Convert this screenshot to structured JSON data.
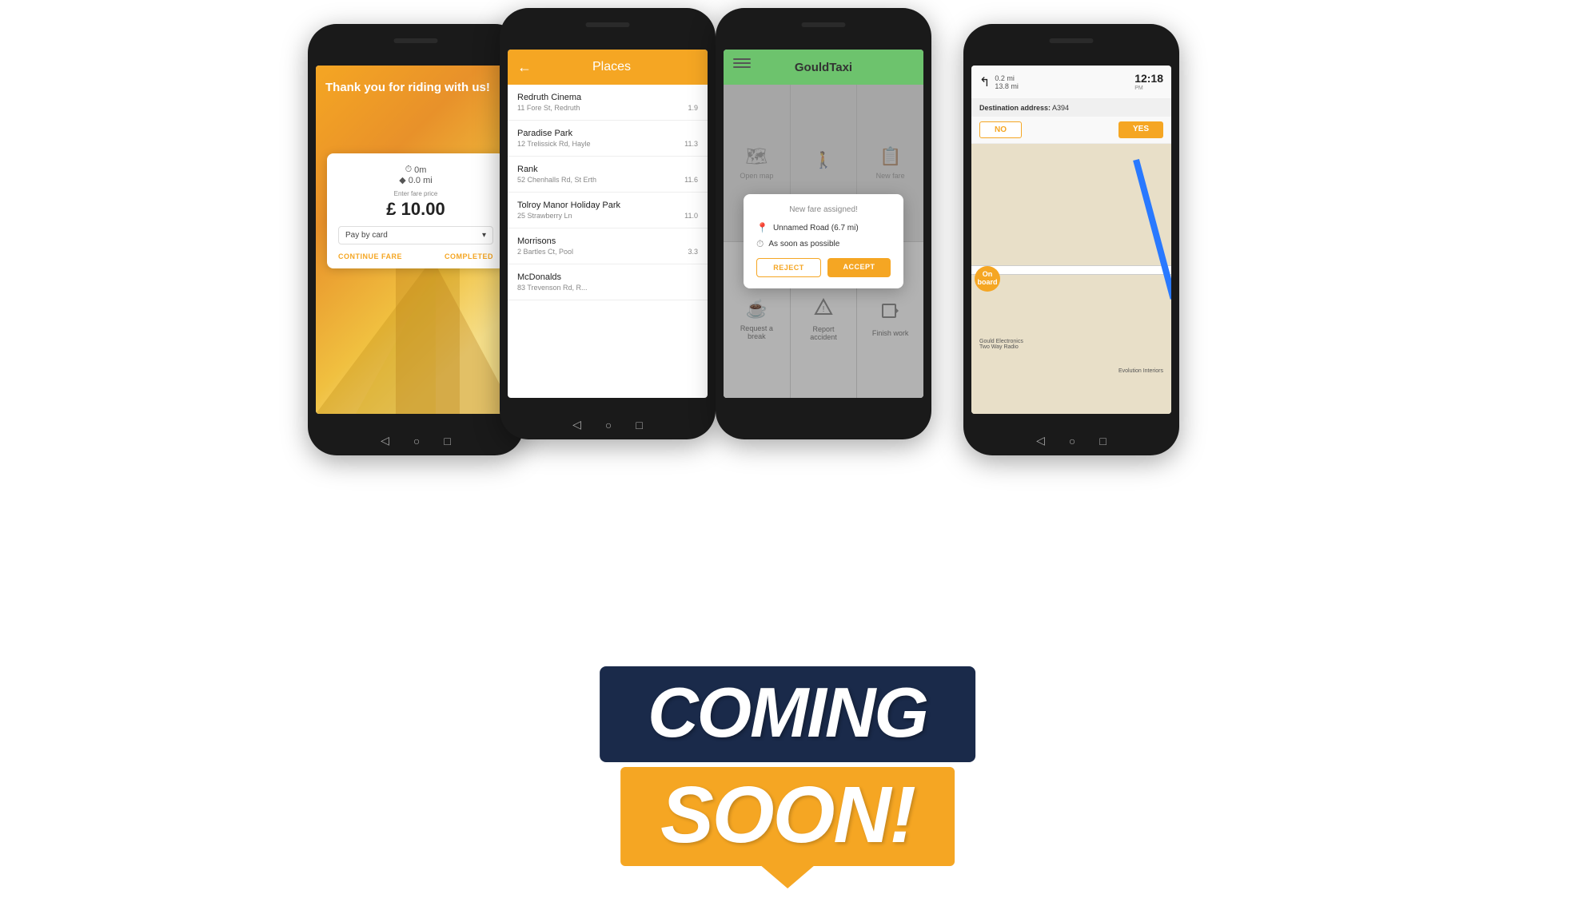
{
  "page": {
    "background": "#ffffff"
  },
  "phone1": {
    "thank_you": "Thank you for riding with us!",
    "time": "0m",
    "distance": "0.0 mi",
    "fare_label": "Enter fare price",
    "price": "£ 10.00",
    "payment": "Pay by card",
    "btn_continue": "CONTINUE FARE",
    "btn_completed": "COMPLETED"
  },
  "phone2": {
    "header_title": "Places",
    "back_arrow": "←",
    "places": [
      {
        "name": "Redruth Cinema",
        "address": "11 Fore St, Redruth",
        "distance": "1.9"
      },
      {
        "name": "Paradise Park",
        "address": "12 Trelissick Rd, Hayle",
        "distance": "11.3"
      },
      {
        "name": "Rank",
        "address": "52 Chenhalls Rd, St Erth",
        "distance": "11.6"
      },
      {
        "name": "Tolroy Manor Holiday Park",
        "address": "25 Strawberry Ln",
        "distance": "11.0"
      },
      {
        "name": "Morrisons",
        "address": "2 Bartles Ct, Pool",
        "distance": "3.3"
      },
      {
        "name": "McDonalds",
        "address": "83 Trevenson Rd, R...",
        "distance": ""
      }
    ]
  },
  "phone3": {
    "app_name": "GouldTaxi",
    "modal": {
      "title": "New fare assigned!",
      "location": "Unnamed Road (6.7 mi)",
      "timing": "As soon as possible",
      "btn_reject": "REJECT",
      "btn_accept": "ACCEPT"
    },
    "grid": [
      {
        "label": "Open map",
        "icon": "map"
      },
      {
        "label": "",
        "icon": "person"
      },
      {
        "label": "New fare",
        "icon": "newfare"
      },
      {
        "label": "Request a break",
        "icon": "coffee"
      },
      {
        "label": "Report accident",
        "icon": "warning"
      },
      {
        "label": "Finish work",
        "icon": "logout"
      }
    ]
  },
  "phone4": {
    "turn_distance": "0.2 mi",
    "total_distance": "13.8 mi",
    "time": "12:18",
    "time_period": "PM",
    "dest_label": "Destination address:",
    "dest_value": "A394",
    "btn_no": "NO",
    "btn_yes": "YES",
    "onboard_label": "On board"
  },
  "banner": {
    "line1": "COMING",
    "line2": "SOON!"
  }
}
